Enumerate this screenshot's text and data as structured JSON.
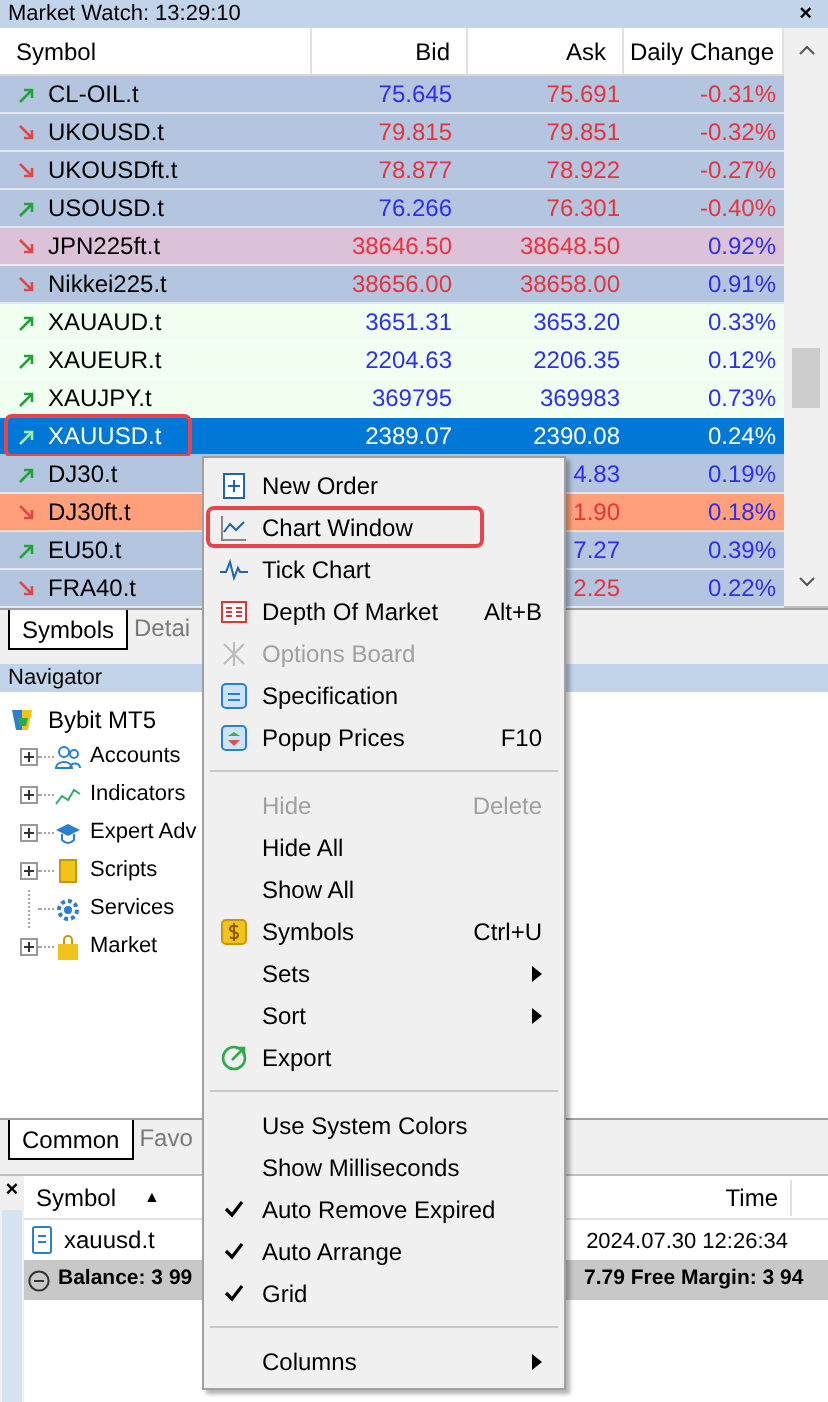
{
  "market_watch": {
    "title": "Market Watch: 13:29:10",
    "close": "×",
    "columns": [
      "Symbol",
      "Bid",
      "Ask",
      "Daily Change"
    ],
    "rows": [
      {
        "symbol": "CL-OIL.t",
        "rising": true,
        "color": "#b4c6df",
        "bid": {
          "text": "75.645",
          "positive": true
        },
        "ask": {
          "text": "75.691",
          "positive": false
        },
        "change": {
          "text": "-0.31%",
          "positive": false
        },
        "selected": false,
        "highlighted": false
      },
      {
        "symbol": "UKOUSD.t",
        "rising": false,
        "color": "#b4c6df",
        "bid": {
          "text": "79.815",
          "positive": false
        },
        "ask": {
          "text": "79.851",
          "positive": false
        },
        "change": {
          "text": "-0.32%",
          "positive": false
        },
        "selected": false,
        "highlighted": false
      },
      {
        "symbol": "UKOUSDft.t",
        "rising": false,
        "color": "#b4c6df",
        "bid": {
          "text": "78.877",
          "positive": false
        },
        "ask": {
          "text": "78.922",
          "positive": false
        },
        "change": {
          "text": "-0.27%",
          "positive": false
        },
        "selected": false,
        "highlighted": false
      },
      {
        "symbol": "USOUSD.t",
        "rising": true,
        "color": "#b4c6df",
        "bid": {
          "text": "76.266",
          "positive": true
        },
        "ask": {
          "text": "76.301",
          "positive": false
        },
        "change": {
          "text": "-0.40%",
          "positive": false
        },
        "selected": false,
        "highlighted": false
      },
      {
        "symbol": "JPN225ft.t",
        "rising": false,
        "color": "#dcc2d8",
        "bid": {
          "text": "38646.50",
          "positive": false
        },
        "ask": {
          "text": "38648.50",
          "positive": false
        },
        "change": {
          "text": "0.92%",
          "positive": true
        },
        "selected": false,
        "highlighted": false
      },
      {
        "symbol": "Nikkei225.t",
        "rising": false,
        "color": "#b4c6df",
        "bid": {
          "text": "38656.00",
          "positive": false
        },
        "ask": {
          "text": "38658.00",
          "positive": false
        },
        "change": {
          "text": "0.91%",
          "positive": true
        },
        "selected": false,
        "highlighted": false
      },
      {
        "symbol": "XAUAUD.t",
        "rising": true,
        "color": "#f0fff0",
        "bid": {
          "text": "3651.31",
          "positive": true
        },
        "ask": {
          "text": "3653.20",
          "positive": true
        },
        "change": {
          "text": "0.33%",
          "positive": true
        },
        "selected": false,
        "highlighted": false
      },
      {
        "symbol": "XAUEUR.t",
        "rising": true,
        "color": "#f0fff0",
        "bid": {
          "text": "2204.63",
          "positive": true
        },
        "ask": {
          "text": "2206.35",
          "positive": true
        },
        "change": {
          "text": "0.12%",
          "positive": true
        },
        "selected": false,
        "highlighted": false
      },
      {
        "symbol": "XAUJPY.t",
        "rising": true,
        "color": "#f0fff0",
        "bid": {
          "text": "369795",
          "positive": true
        },
        "ask": {
          "text": "369983",
          "positive": true
        },
        "change": {
          "text": "0.73%",
          "positive": true
        },
        "selected": false,
        "highlighted": false
      },
      {
        "symbol": "XAUUSD.t",
        "rising": true,
        "bid": {
          "text": "2389.07"
        },
        "ask": {
          "text": "2390.08"
        },
        "change": {
          "text": "0.24%"
        },
        "selected": true,
        "highlighted": true
      },
      {
        "symbol": "DJ30.t",
        "rising": true,
        "color": "#b4c6df",
        "ask": {
          "text": "4.83",
          "positive": true
        },
        "change": {
          "text": "0.19%",
          "positive": true
        },
        "selected": false,
        "highlighted": false
      },
      {
        "symbol": "DJ30ft.t",
        "rising": false,
        "color": "#ffa07a",
        "ask": {
          "text": "1.90",
          "positive": false
        },
        "change": {
          "text": "0.18%",
          "positive": true
        },
        "selected": false,
        "highlighted": false
      },
      {
        "symbol": "EU50.t",
        "rising": true,
        "color": "#b4c6df",
        "ask": {
          "text": "7.27",
          "positive": true
        },
        "change": {
          "text": "0.39%",
          "positive": true
        },
        "selected": false,
        "highlighted": false
      },
      {
        "symbol": "FRA40.t",
        "rising": false,
        "color": "#b4c6df",
        "ask": {
          "text": "2.25",
          "positive": false
        },
        "change": {
          "text": "0.22%",
          "positive": true
        },
        "selected": false,
        "highlighted": false
      }
    ],
    "tabs": [
      {
        "label": "Symbols",
        "selected": true
      },
      {
        "label": "Detai",
        "selected": false
      }
    ]
  },
  "navigator": {
    "title": "Navigator",
    "tree": [
      {
        "label": "Bybit MT5",
        "children": [
          {
            "label": "Accounts",
            "expandable": true
          },
          {
            "label": "Indicators",
            "expandable": true
          },
          {
            "label": "Expert Adv",
            "expandable": true
          },
          {
            "label": "Scripts",
            "expandable": true
          },
          {
            "label": "Services",
            "expandable": false
          },
          {
            "label": "Market",
            "expandable": true
          }
        ]
      }
    ],
    "tabs": [
      {
        "label": "Common",
        "selected": true
      },
      {
        "label": "Favo",
        "selected": false
      }
    ]
  },
  "toolbox": {
    "close": "×",
    "columns": [
      "Symbol",
      "Time"
    ],
    "sort_mark": "▲",
    "rows": [
      {
        "symbol": "xauusd.t",
        "time": "2024.07.30 12:26:34"
      }
    ],
    "balance": {
      "left": "Balance: 3 99",
      "right": "7.79 Free Margin: 3 94"
    }
  },
  "context_menu": [
    {
      "kind": "item",
      "label": "New Order"
    },
    {
      "kind": "item",
      "label": "Chart Window",
      "highlighted": true
    },
    {
      "kind": "item",
      "label": "Tick Chart"
    },
    {
      "kind": "item",
      "label": "Depth Of Market",
      "shortcut": "Alt+B"
    },
    {
      "kind": "item",
      "label": "Options Board",
      "disabled": true
    },
    {
      "kind": "item",
      "label": "Specification"
    },
    {
      "kind": "item",
      "label": "Popup Prices",
      "shortcut": "F10"
    },
    {
      "kind": "separator"
    },
    {
      "kind": "item",
      "label": "Hide",
      "shortcut": "Delete",
      "disabled": true
    },
    {
      "kind": "item",
      "label": "Hide All"
    },
    {
      "kind": "item",
      "label": "Show All"
    },
    {
      "kind": "item",
      "label": "Symbols",
      "shortcut": "Ctrl+U"
    },
    {
      "kind": "item",
      "label": "Sets",
      "submenu": true
    },
    {
      "kind": "item",
      "label": "Sort",
      "submenu": true
    },
    {
      "kind": "item",
      "label": "Export"
    },
    {
      "kind": "separator"
    },
    {
      "kind": "item",
      "label": "Use System Colors"
    },
    {
      "kind": "item",
      "label": "Show Milliseconds"
    },
    {
      "kind": "item",
      "label": "Auto Remove Expired",
      "checked": true
    },
    {
      "kind": "item",
      "label": "Auto Arrange",
      "checked": true
    },
    {
      "kind": "item",
      "label": "Grid",
      "checked": true
    },
    {
      "kind": "separator"
    },
    {
      "kind": "item",
      "label": "Columns",
      "submenu": true
    }
  ]
}
